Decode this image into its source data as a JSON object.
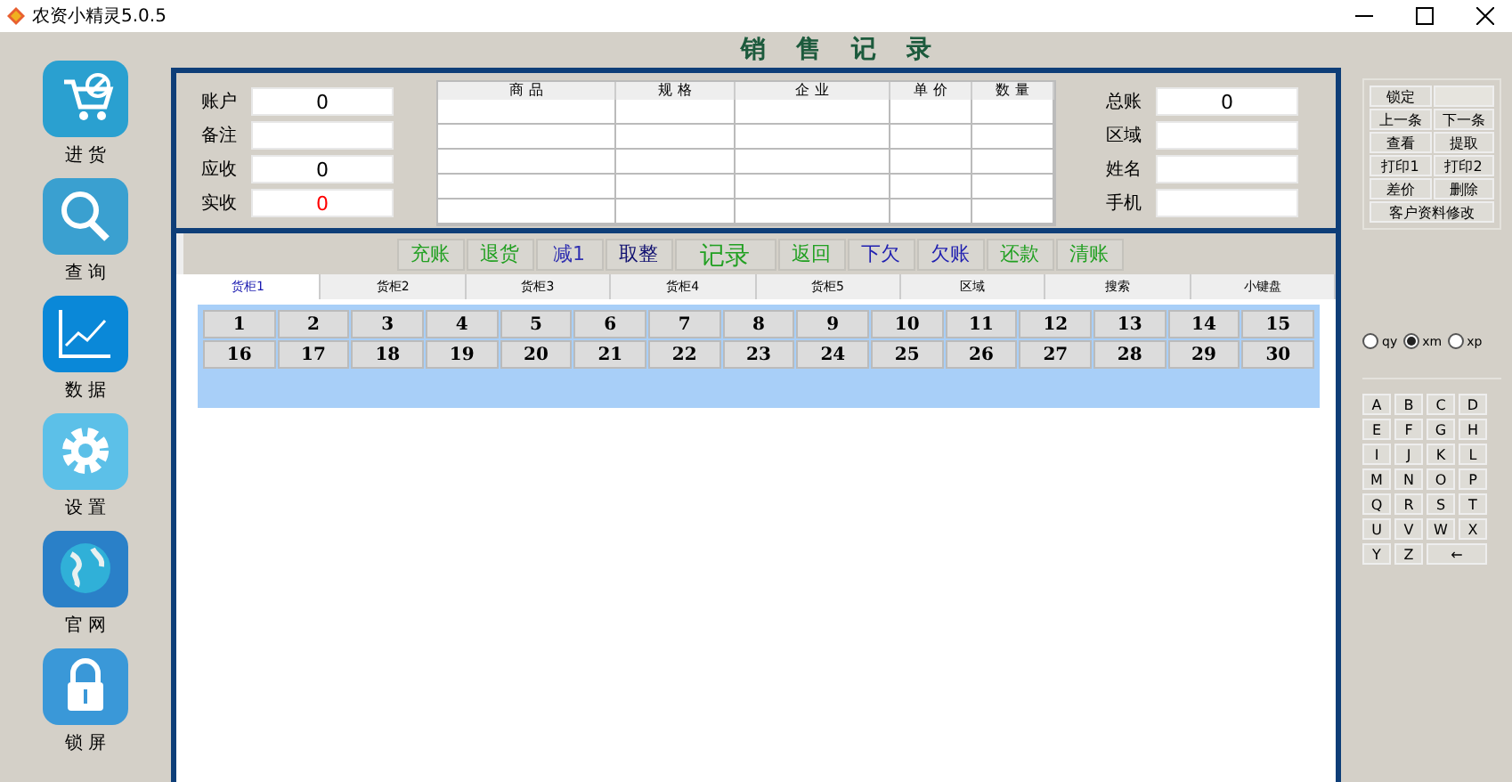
{
  "window": {
    "title": "农资小精灵5.0.5"
  },
  "page_title": "销 售 记 录",
  "sidebar": [
    {
      "label": "进 货",
      "kind": "cart"
    },
    {
      "label": "查 询",
      "kind": "search"
    },
    {
      "label": "数 据",
      "kind": "chart"
    },
    {
      "label": "设 置",
      "kind": "gear"
    },
    {
      "label": "官 网",
      "kind": "globe"
    },
    {
      "label": "锁 屏",
      "kind": "lock"
    }
  ],
  "left_fields": [
    {
      "label": "账户",
      "value": "0",
      "color": "#000000"
    },
    {
      "label": "备注"
    },
    {
      "label": "应收",
      "value": "0",
      "color": "#000000"
    },
    {
      "label": "实收",
      "value": "0",
      "color": "#ff0000"
    }
  ],
  "table": {
    "columns": [
      "商 品",
      "规 格",
      "企 业",
      "单 价",
      "数 量"
    ]
  },
  "right_fields": [
    {
      "label": "总账",
      "value": "0",
      "color": "#000000"
    },
    {
      "label": "区域"
    },
    {
      "label": "姓名"
    },
    {
      "label": "手机"
    }
  ],
  "actions": [
    {
      "label": "充账",
      "color": "#22a022",
      "kind": "normal"
    },
    {
      "label": "退货",
      "color": "#22a022",
      "kind": "normal"
    },
    {
      "label": "减1",
      "color": "#3030b0",
      "kind": "normal"
    },
    {
      "label": "取整",
      "color": "#101070",
      "kind": "normal"
    },
    {
      "label": "记录",
      "color": "#22a022",
      "kind": "large"
    },
    {
      "label": "返回",
      "color": "#22a022",
      "kind": "normal"
    },
    {
      "label": "下欠",
      "color": "#2020b0",
      "kind": "normal"
    },
    {
      "label": "欠账",
      "color": "#2020b0",
      "kind": "normal"
    },
    {
      "label": "还款",
      "color": "#22a022",
      "kind": "normal"
    },
    {
      "label": "清账",
      "color": "#22a022",
      "kind": "normal"
    }
  ],
  "tabs": [
    {
      "label": "货柜1",
      "selected": true
    },
    {
      "label": "货柜2",
      "selected": false
    },
    {
      "label": "货柜3",
      "selected": false
    },
    {
      "label": "货柜4",
      "selected": false
    },
    {
      "label": "货柜5",
      "selected": false
    },
    {
      "label": "区域",
      "selected": false
    },
    {
      "label": "搜索",
      "selected": false
    },
    {
      "label": "小键盘",
      "selected": false
    }
  ],
  "slots": [
    "1",
    "2",
    "3",
    "4",
    "5",
    "6",
    "7",
    "8",
    "9",
    "10",
    "11",
    "12",
    "13",
    "14",
    "15",
    "16",
    "17",
    "18",
    "19",
    "20",
    "21",
    "22",
    "23",
    "24",
    "25",
    "26",
    "27",
    "28",
    "29",
    "30"
  ],
  "record_buttons": [
    {
      "label": "锁定",
      "kind": "pair_field"
    },
    {
      "label": "上一条",
      "kind": "half"
    },
    {
      "label": "下一条",
      "kind": "half"
    },
    {
      "label": "查看",
      "kind": "half"
    },
    {
      "label": "提取",
      "kind": "half"
    },
    {
      "label": "打印1",
      "kind": "half"
    },
    {
      "label": "打印2",
      "kind": "half"
    },
    {
      "label": "差价",
      "kind": "half"
    },
    {
      "label": "删除",
      "kind": "half"
    },
    {
      "label": "客户资料修改",
      "kind": "wide"
    }
  ],
  "modes": [
    {
      "label": "qy",
      "selected": false
    },
    {
      "label": "xm",
      "selected": true
    },
    {
      "label": "xp",
      "selected": false
    }
  ],
  "keys": [
    "A",
    "B",
    "C",
    "D",
    "E",
    "F",
    "G",
    "H",
    "I",
    "J",
    "K",
    "L",
    "M",
    "N",
    "O",
    "P",
    "Q",
    "R",
    "S",
    "T",
    "U",
    "V",
    "W",
    "X",
    "Y",
    "Z",
    "←"
  ]
}
